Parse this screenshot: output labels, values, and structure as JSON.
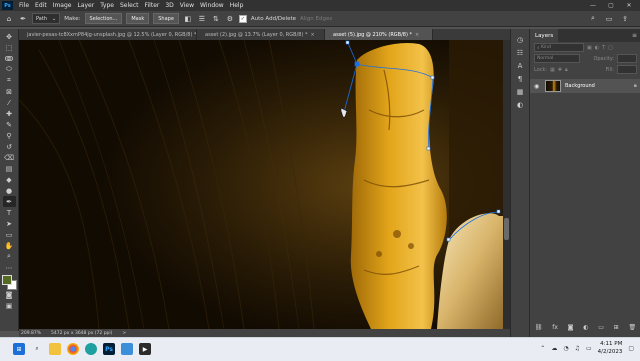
{
  "menubar": {
    "logo": "Ps",
    "items": [
      "File",
      "Edit",
      "Image",
      "Layer",
      "Type",
      "Select",
      "Filter",
      "3D",
      "View",
      "Window",
      "Help"
    ],
    "window_controls": [
      "—",
      "▢",
      "✕"
    ]
  },
  "options": {
    "mode": "Path",
    "make_label": "Make:",
    "selection_button": "Selection...",
    "mask_button": "Mask",
    "shape_button": "Shape",
    "auto_add_delete_label": "Auto Add/Delete",
    "auto_add_delete_checked": "✓",
    "align_edges_label": "Align Edges"
  },
  "tabs": [
    {
      "label": "javier-pesas-tc8XxmP84jg-unsplash.jpg @ 12.5% (Layer 0, RGB/8) *",
      "close": "×"
    },
    {
      "label": "asset (2).jpg @ 13.7% (Layer 0, RGB/8) *",
      "close": "×"
    },
    {
      "label": "asset (5).jpg @ 210% (RGB/8) *",
      "close": "×"
    }
  ],
  "status": {
    "zoom": "209.87%",
    "doc_size": "5472 px x 3648 px (72 ppi)",
    "more": ">"
  },
  "colors": {
    "foreground": "#556b23",
    "background": "#ffffff",
    "path": "#1a6fe8",
    "accent": "#31a8ff"
  },
  "layers_panel": {
    "title": "Layers",
    "menu": "≡",
    "kind_placeholder": "Kind",
    "blend_mode": "Normal",
    "opacity_label": "Opacity:",
    "lock_label": "Lock:",
    "fill_label": "Fill:",
    "layer_name": "Background"
  },
  "taskbar": {
    "time": "4:11 PM",
    "date": "4/2/2023"
  }
}
